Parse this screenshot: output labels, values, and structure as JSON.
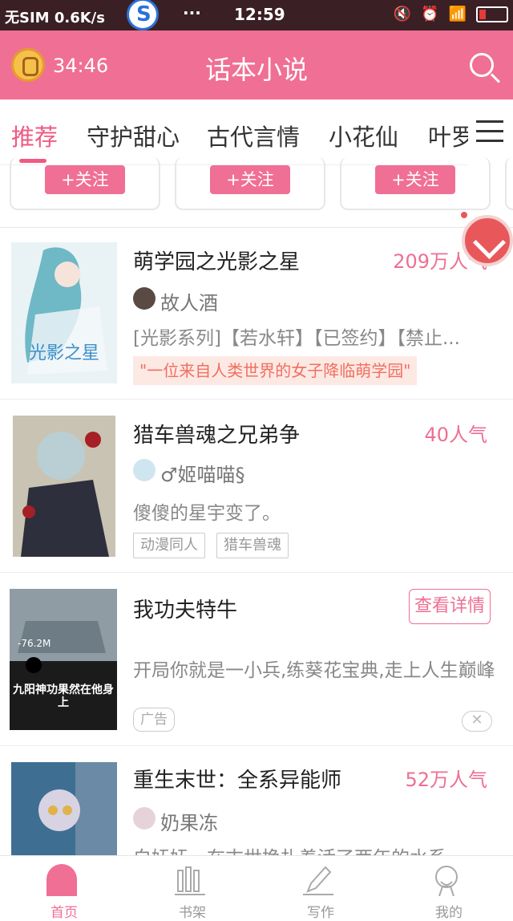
{
  "status_bar": {
    "carrier": "无SIM 0.6K/s",
    "dots": "···",
    "time": "12:59"
  },
  "header": {
    "timer": "34:46",
    "title": "话本小说"
  },
  "tabs": [
    "推荐",
    "守护甜心",
    "古代言情",
    "小花仙",
    "叶罗丽"
  ],
  "follow_cards": [
    "+关注",
    "+关注",
    "+关注"
  ],
  "books": [
    {
      "title": "萌学园之光影之星",
      "popularity": "209万人气",
      "author": "故人酒",
      "tags_line": "[光影系列]【若水轩】【已签约】【禁止...",
      "quote": "\"一位来自人类世界的女子降临萌学园\"",
      "cover_title": "光影之星"
    },
    {
      "title": "猎车兽魂之兄弟争",
      "popularity": "40人气",
      "author": "♂姬喵喵§",
      "desc": "傻傻的星宇变了。",
      "tags": [
        "动漫同人",
        "猎车兽魂"
      ]
    },
    {
      "title": "我功夫特牛",
      "detail_button": "查看详情",
      "desc": "开局你就是一小兵,练葵花宝典,走上人生巅峰",
      "ad_label": "广告",
      "cover_caption": "九阳神功果然在他身上",
      "cover_number": "-76.2M"
    },
    {
      "title": "重生末世：全系异能师",
      "popularity": "52万人气",
      "author": "奶果冻",
      "desc": "白妩妩，在末世挣扎着活了两年的水系"
    }
  ],
  "bottom_nav": [
    "首页",
    "书架",
    "写作",
    "我的"
  ],
  "colors": {
    "accent": "#f06f94",
    "status_bar": "#3a1f24"
  }
}
